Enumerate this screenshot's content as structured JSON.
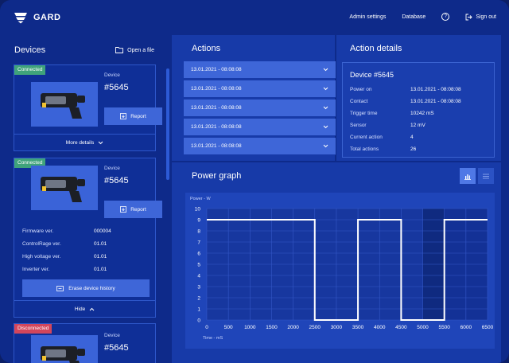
{
  "app": {
    "name": "GARD"
  },
  "nav": {
    "admin": "Admin settings",
    "database": "Database",
    "help": "?",
    "signout": "Sign out"
  },
  "devices": {
    "title": "Devices",
    "open_file": "Open a file",
    "cards": [
      {
        "status": "Connected",
        "label": "Device",
        "number": "#5645",
        "report": "Report",
        "footer": "More details"
      },
      {
        "status": "Connected",
        "label": "Device",
        "number": "#5645",
        "report": "Report",
        "footer": "Hide",
        "specs": [
          {
            "k": "Firmware ver.",
            "v": "000004"
          },
          {
            "k": "ControlRage ver.",
            "v": "01.01"
          },
          {
            "k": "High voltage ver.",
            "v": "01.01"
          },
          {
            "k": "Inverter ver.",
            "v": "01.01"
          }
        ],
        "erase": "Erase device history"
      },
      {
        "status": "Disconnected",
        "label": "Device",
        "number": "#5645"
      }
    ]
  },
  "actions": {
    "title": "Actions",
    "items": [
      "13.01.2021 - 08:08:08",
      "13.01.2021 - 08:08:08",
      "13.01.2021 - 08:08:08",
      "13.01.2021 - 08:08:08",
      "13.01.2021 - 08:08:08"
    ]
  },
  "details": {
    "title": "Action details",
    "device": "Device #5645",
    "rows": [
      {
        "k": "Power on",
        "v": "13.01.2021 - 08:08:08"
      },
      {
        "k": "Contact",
        "v": "13.01.2021 - 08:08:08"
      },
      {
        "k": "Trigger time",
        "v": "10242 mS"
      },
      {
        "k": "Sensor",
        "v": "12 mV"
      },
      {
        "k": "Current action",
        "v": "4"
      },
      {
        "k": "Total actions",
        "v": "26"
      }
    ]
  },
  "graph": {
    "title": "Power graph"
  },
  "colors": {
    "accent": "#3e66d8",
    "connected": "#3fa37b",
    "disconnected": "#d2465c",
    "bg": "#0e2a8a"
  },
  "chart_data": {
    "type": "line",
    "ylabel": "Power - W",
    "xlabel": "Time - mS",
    "ylim": [
      0,
      10
    ],
    "xlim": [
      0,
      6500
    ],
    "x_ticks": [
      0,
      500,
      1000,
      1500,
      2000,
      2500,
      3000,
      3500,
      4000,
      4500,
      5000,
      5500,
      6000,
      6500
    ],
    "y_ticks": [
      0,
      1,
      2,
      3,
      4,
      5,
      6,
      7,
      8,
      9,
      10
    ],
    "series": [
      {
        "x": [
          0,
          2500,
          2500,
          3500,
          3500,
          4500,
          4500,
          5500,
          5500,
          6500
        ],
        "y": [
          9,
          9,
          0,
          0,
          9,
          9,
          0,
          0,
          9,
          9
        ]
      }
    ],
    "grid": true
  }
}
